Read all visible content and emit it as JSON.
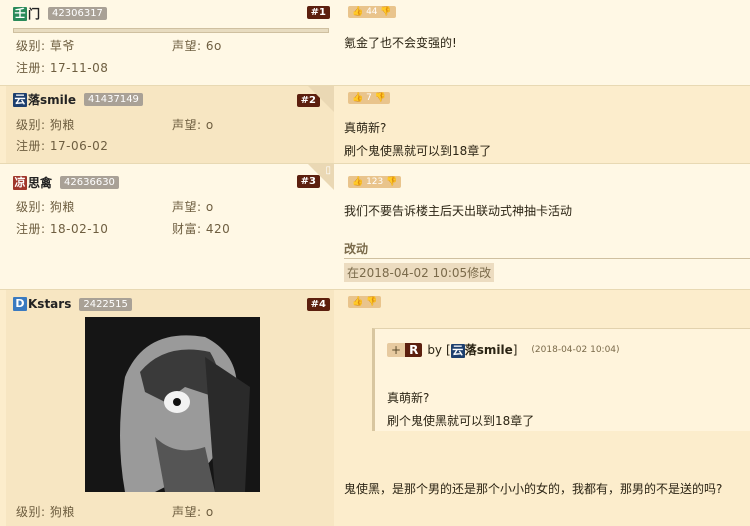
{
  "posts": [
    {
      "name": "门",
      "badge": "壬",
      "badge_color": "#2a8a5a",
      "uid": "42306317",
      "floor": "#1",
      "level_label": "级别:",
      "level": "草爷",
      "rep_label": "声望:",
      "rep": "6o",
      "reg_label": "注册:",
      "reg": "17-11-08",
      "likes": "44",
      "lines": [
        "氪金了也不会变强的!"
      ]
    },
    {
      "name": "落smile",
      "badge": "云",
      "badge_color": "#1d3f6e",
      "uid": "41437149",
      "floor": "#2",
      "level_label": "级别:",
      "level": "狗粮",
      "rep_label": "声望:",
      "rep": "o",
      "reg_label": "注册:",
      "reg": "17-06-02",
      "likes": "7",
      "lines": [
        "真萌新?",
        "刷个鬼使黑就可以到18章了"
      ]
    },
    {
      "name": "思禽",
      "badge": "凉",
      "badge_color": "#a0362a",
      "uid": "42636630",
      "floor": "#3",
      "level_label": "级别:",
      "level": "狗粮",
      "rep_label": "声望:",
      "rep": "o",
      "reg_label": "注册:",
      "reg": "18-02-10",
      "wealth_label": "财富:",
      "wealth": "420",
      "likes": "123",
      "lines": [
        "我们不要告诉楼主后天出联动式神抽卡活动"
      ],
      "edit_title": "改动",
      "edit_note": "在2018-04-02 10:05修改"
    },
    {
      "name": "Kstars",
      "badge": "D",
      "badge_color": "#3a7ac0",
      "uid": "2422515",
      "floor": "#4",
      "level_label": "级别:",
      "level": "狗粮",
      "rep_label": "声望:",
      "rep": "o",
      "likes": "",
      "quote": {
        "plus": "+",
        "r": "R",
        "by": "by",
        "user_badge": "云",
        "user": "落smile",
        "time": "(2018-04-02 10:04)",
        "lines": [
          "真萌新?",
          "刷个鬼使黑就可以到18章了"
        ]
      },
      "lines": [
        "鬼使黑，是那个男的还是那个小小的女的，我都有，那男的不是送的吗?"
      ]
    }
  ]
}
